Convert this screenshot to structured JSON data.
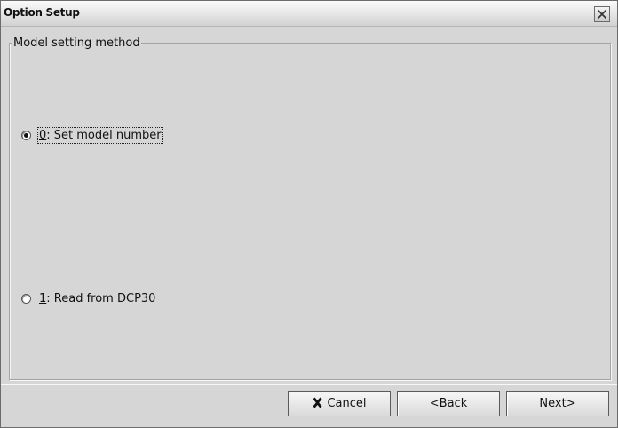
{
  "window": {
    "title": "Option Setup"
  },
  "groupbox": {
    "legend": "Model setting method"
  },
  "options": [
    {
      "mnemonic": "0",
      "text": ": Set model number",
      "selected": true
    },
    {
      "mnemonic": "1",
      "text": ": Read from DCP30",
      "selected": false
    }
  ],
  "buttons": {
    "cancel_label": "Cancel",
    "cancel_icon": "x-icon",
    "back_prefix": "<",
    "back_mnemonic": "B",
    "back_rest": "ack",
    "next_mnemonic": "N",
    "next_rest": "ext>"
  }
}
